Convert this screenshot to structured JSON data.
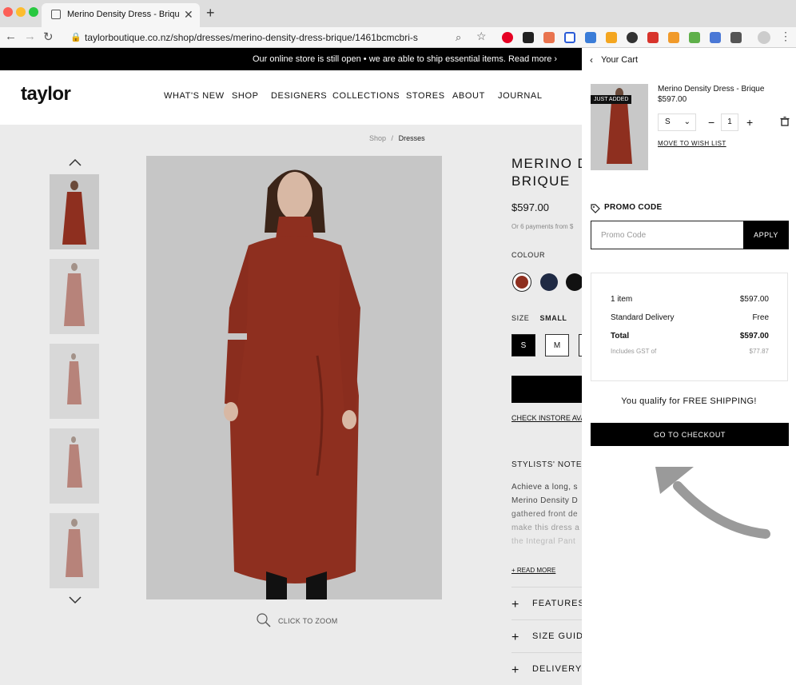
{
  "browser": {
    "tab_title": "Merino Density Dress - Brique",
    "url": "taylorboutique.co.nz/shop/dresses/merino-density-dress-brique/1461bcmcbri-s"
  },
  "site": {
    "announcement": "Our online store is still open • we are able to ship essential items. Read more ›",
    "logo": "taylor",
    "nav": [
      "WHAT'S NEW",
      "SHOP",
      "DESIGNERS",
      "COLLECTIONS",
      "STORES",
      "ABOUT",
      "JOURNAL"
    ],
    "breadcrumb": {
      "parent": "Shop",
      "separator": "/",
      "current": "Dresses"
    },
    "zoom_label": "CLICK TO ZOOM"
  },
  "product": {
    "title_line1": "MERINO D",
    "title_line2": "BRIQUE",
    "price": "$597.00",
    "payments_note": "Or 6 payments from $",
    "colour_label": "COLOUR",
    "colours": [
      "#8e2f1f",
      "#1f2a44",
      "#111111"
    ],
    "size_label": "SIZE",
    "size_selected": "SMALL",
    "sizes": [
      "S",
      "M"
    ],
    "instore_link": "CHECK INSTORE AVA",
    "stylists_notes_title": "STYLISTS' NOTES",
    "notes_lines": [
      "Achieve a long, s",
      "Merino Density D",
      "gathered front de",
      "make this dress a",
      "the Integral Pant"
    ],
    "read_more": "+ READ MORE",
    "accordions": [
      "FEATURES",
      "SIZE GUIDE",
      "DELIVERY &"
    ]
  },
  "cart": {
    "title": "Your Cart",
    "badge": "JUST ADDED",
    "item_name": "Merino Density Dress - Brique",
    "item_price": "$597.00",
    "item_size": "S",
    "item_qty": "1",
    "wishlist_link": "MOVE TO WISH LIST",
    "promo_title": "PROMO CODE",
    "promo_placeholder": "Promo Code",
    "apply_label": "APPLY",
    "summary": {
      "items_label": "1 item",
      "items_value": "$597.00",
      "delivery_label": "Standard Delivery",
      "delivery_value": "Free",
      "total_label": "Total",
      "total_value": "$597.00",
      "gst_label": "Includes GST of",
      "gst_value": "$77.87"
    },
    "free_shipping": "You qualify for FREE SHIPPING!",
    "checkout_label": "GO TO CHECKOUT"
  }
}
